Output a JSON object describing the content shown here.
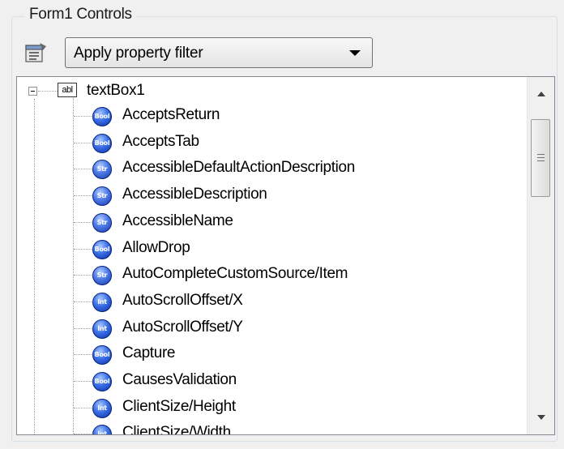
{
  "group": {
    "title": "Form1 Controls"
  },
  "toolbar": {
    "icon": "property-pages-icon",
    "filter_label": "Apply property filter"
  },
  "tree": {
    "root": {
      "icon_text": "abl",
      "label": "textBox1"
    },
    "items": [
      {
        "type": "Bool",
        "label": "AcceptsReturn"
      },
      {
        "type": "Bool",
        "label": "AcceptsTab"
      },
      {
        "type": "Str",
        "label": "AccessibleDefaultActionDescription"
      },
      {
        "type": "Str",
        "label": "AccessibleDescription"
      },
      {
        "type": "Str",
        "label": "AccessibleName"
      },
      {
        "type": "Bool",
        "label": "AllowDrop"
      },
      {
        "type": "Str",
        "label": "AutoCompleteCustomSource/Item"
      },
      {
        "type": "Int",
        "label": "AutoScrollOffset/X"
      },
      {
        "type": "Int",
        "label": "AutoScrollOffset/Y"
      },
      {
        "type": "Bool",
        "label": "Capture"
      },
      {
        "type": "Bool",
        "label": "CausesValidation"
      },
      {
        "type": "Int",
        "label": "ClientSize/Height"
      },
      {
        "type": "Int",
        "label": "ClientSize/Width"
      }
    ]
  }
}
